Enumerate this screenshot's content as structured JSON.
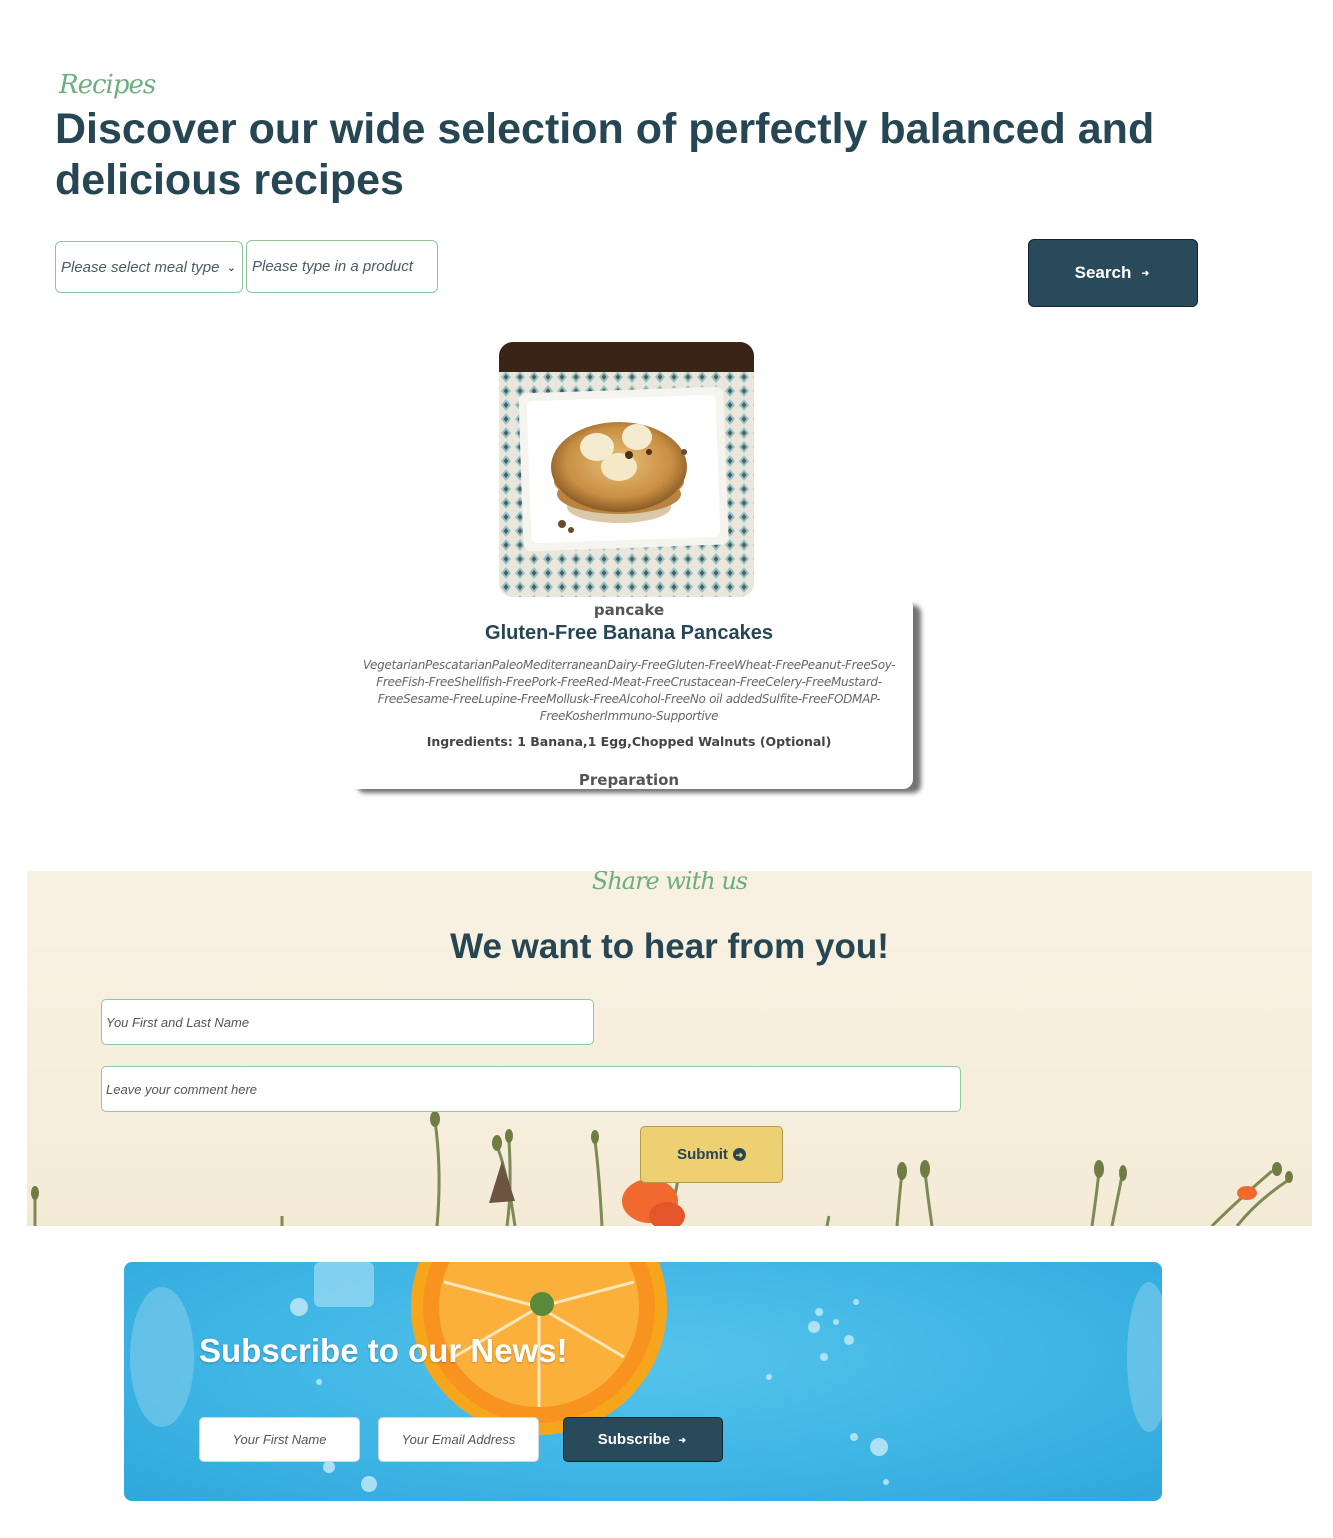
{
  "recipes": {
    "eyebrow": "Recipes",
    "headline": "Discover our wide selection of perfectly balanced and delicious recipes"
  },
  "search": {
    "meal_type_selected": "Please select meal type",
    "product_placeholder": "Please type in a product",
    "button_label": "Search",
    "button_icon": "arrow-right-circle-icon"
  },
  "recipe_card": {
    "image_alt": "banana pancakes on a square white plate",
    "category": "pancake",
    "title": "Gluten-Free Banana Pancakes",
    "tags": "VegetarianPescatarianPaleoMediterraneanDairy-FreeGluten-FreeWheat-FreePeanut-FreeSoy-FreeFish-FreeShellfish-FreePork-FreeRed-Meat-FreeCrustacean-FreeCelery-FreeMustard-FreeSesame-FreeLupine-FreeMollusk-FreeAlcohol-FreeNo oil addedSulfite-FreeFODMAP-FreeKosherImmuno-Supportive",
    "ingredients": "Ingredients: 1 Banana,1 Egg,Chopped Walnuts (Optional)",
    "preparation_label": "Preparation"
  },
  "share": {
    "eyebrow": "Share with us",
    "title": "We want to hear from you!",
    "name_placeholder": "You First and Last Name",
    "comment_placeholder": "Leave your comment here",
    "submit_label": "Submit",
    "submit_icon": "arrow-right-circle-icon"
  },
  "subscribe": {
    "title": "Subscribe to our News!",
    "first_name_placeholder": "Your First Name",
    "email_placeholder": "Your Email Address",
    "button_label": "Subscribe",
    "button_icon": "arrow-right-circle-icon"
  },
  "colors": {
    "primary": "#264653",
    "accent_green": "#6daf7c",
    "button_dark": "#284a5a",
    "submit_yellow": "#ecd072",
    "subscribe_blue": "#3db4e4",
    "share_background": "#f8f1e2"
  }
}
